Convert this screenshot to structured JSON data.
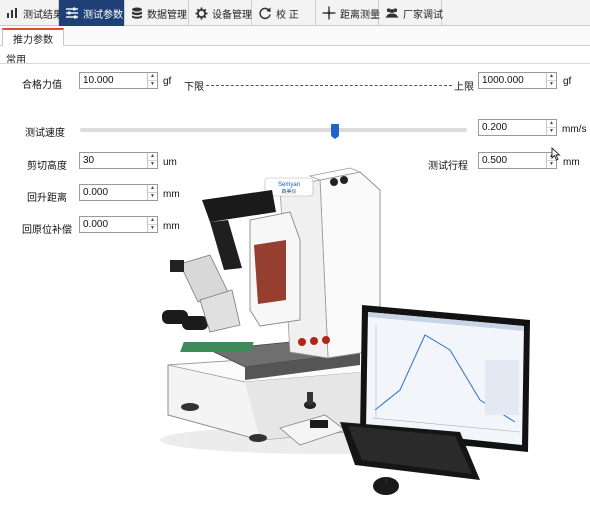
{
  "toolbar": {
    "items": [
      {
        "label": "测试结果",
        "icon": "bar-chart-icon"
      },
      {
        "label": "测试参数",
        "icon": "sliders-icon"
      },
      {
        "label": "数据管理",
        "icon": "database-icon"
      },
      {
        "label": "设备管理",
        "icon": "gear-icon"
      },
      {
        "label": "校  正",
        "icon": "refresh-icon"
      },
      {
        "label": "距离测量",
        "icon": "crosshair-icon"
      },
      {
        "label": "厂家调试",
        "icon": "users-icon"
      }
    ],
    "active_index": 1
  },
  "subtab": {
    "label": "推力参数"
  },
  "section": {
    "label": "常用"
  },
  "form": {
    "pass_force": {
      "label": "合格力值",
      "value": "10.000",
      "unit": "gf"
    },
    "lower_limit": {
      "label": "下限"
    },
    "upper_limit": {
      "label": "上限",
      "value": "1000.000",
      "unit": "gf"
    },
    "test_speed": {
      "label": "测试速度",
      "value": "0.200",
      "unit": "mm/s",
      "slider_fraction": 0.66
    },
    "shear_height": {
      "label": "剪切高度",
      "value": "30",
      "unit": "um"
    },
    "test_travel": {
      "label": "测试行程",
      "value": "0.500",
      "unit": "mm"
    },
    "lift_distance": {
      "label": "回升距离",
      "value": "0.000",
      "unit": "mm"
    },
    "home_compensation": {
      "label": "回原位补偿",
      "value": "0.000",
      "unit": "mm"
    }
  },
  "equipment": {
    "brand_badge": "Semyan",
    "brand_badge_cn": "森美仪"
  },
  "colors": {
    "toolbar_active": "#1f3f77",
    "tab_accent": "#e24a2a",
    "slider_thumb": "#1f64c8"
  }
}
